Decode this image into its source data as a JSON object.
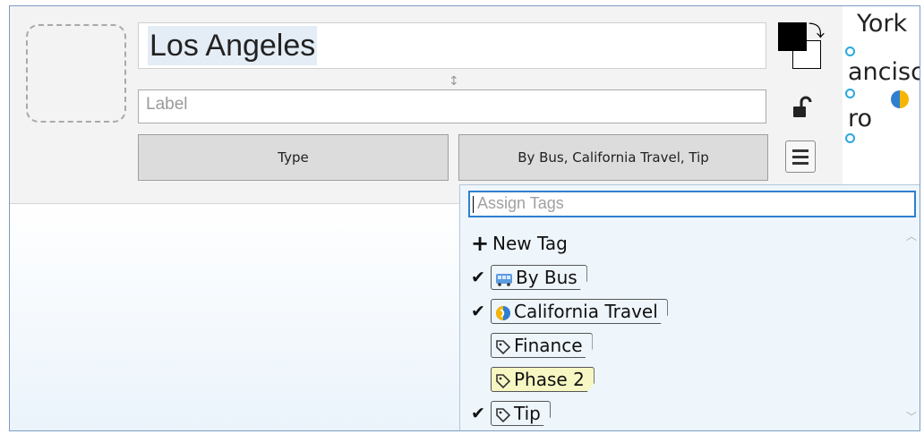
{
  "map": {
    "labels": [
      "York",
      "ancisco",
      "ro"
    ]
  },
  "editor": {
    "title_value": "Los Angeles",
    "label_placeholder": "Label",
    "type_button": "Type",
    "tags_button": "By Bus, California Travel, Tip"
  },
  "tags_dropdown": {
    "search_placeholder": "Assign Tags",
    "new_tag_label": "New Tag",
    "items": [
      {
        "label": "By Bus",
        "checked": true,
        "icon": "bus-icon"
      },
      {
        "label": "California Travel",
        "checked": true,
        "icon": "california-travel-icon"
      },
      {
        "label": "Finance",
        "checked": false,
        "icon": "tag-icon"
      },
      {
        "label": "Phase 2",
        "checked": false,
        "icon": "tag-icon",
        "highlighted": true
      },
      {
        "label": "Tip",
        "checked": true,
        "icon": "tag-icon"
      }
    ]
  },
  "colors": {
    "accent": "#2f7fd0",
    "node": "#29a8e0",
    "highlight": "#f7f7c3"
  }
}
